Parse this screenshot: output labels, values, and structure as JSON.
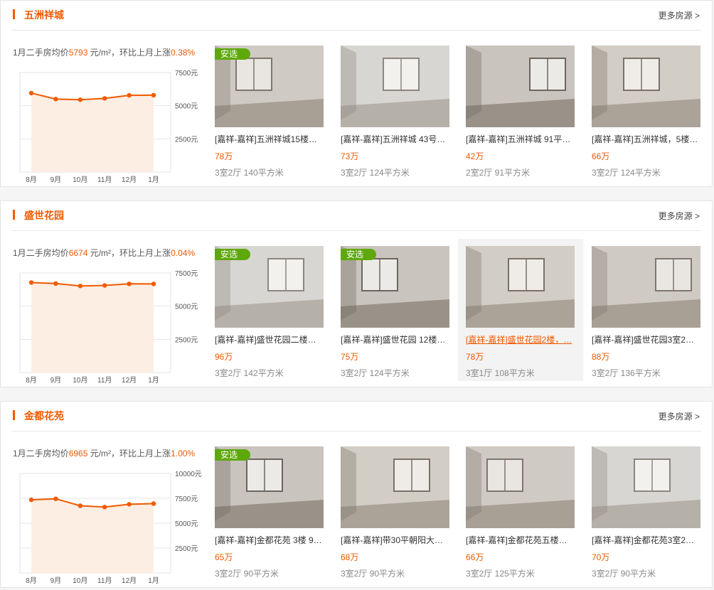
{
  "sections": [
    {
      "title": "五洲祥城",
      "more": "更多房源 >",
      "price_prefix": "1月二手房均价",
      "price_value": "5793",
      "price_unit": " 元/m²，环比上月上涨",
      "price_change": "0.38%",
      "chart_data": {
        "type": "line",
        "categories": [
          "8月",
          "9月",
          "10月",
          "11月",
          "12月",
          "1月"
        ],
        "values": [
          5950,
          5500,
          5450,
          5550,
          5780,
          5793
        ],
        "yticks": [
          "7500元",
          "5000元",
          "2500元"
        ],
        "ylim": [
          0,
          7500
        ]
      },
      "listings": [
        {
          "tag": "安选",
          "name": "[嘉祥-嘉祥]五洲祥城15楼…",
          "price": "78万",
          "spec": "3室2厅 140平方米"
        },
        {
          "tag": "",
          "name": "[嘉祥-嘉祥]五洲祥城 43号…",
          "price": "73万",
          "spec": "3室2厅 124平方米"
        },
        {
          "tag": "",
          "name": "[嘉祥-嘉祥]五洲祥城 91平…",
          "price": "42万",
          "spec": "2室2厅 91平方米"
        },
        {
          "tag": "",
          "name": "[嘉祥-嘉祥]五洲祥城，5楼…",
          "price": "66万",
          "spec": "3室2厅 124平方米"
        }
      ]
    },
    {
      "title": "盛世花园",
      "more": "更多房源 >",
      "price_prefix": "1月二手房均价",
      "price_value": "6674",
      "price_unit": " 元/m²，环比上月上涨",
      "price_change": "0.04%",
      "chart_data": {
        "type": "line",
        "categories": [
          "8月",
          "9月",
          "10月",
          "11月",
          "12月",
          "1月"
        ],
        "values": [
          6780,
          6700,
          6520,
          6560,
          6680,
          6674
        ],
        "yticks": [
          "7500元",
          "5000元",
          "2500元"
        ],
        "ylim": [
          0,
          7500
        ]
      },
      "listings": [
        {
          "tag": "安选",
          "name": "[嘉祥-嘉祥]盛世花园二楼…",
          "price": "96万",
          "spec": "3室2厅 142平方米"
        },
        {
          "tag": "安选",
          "name": "[嘉祥-嘉祥]盛世花园 12楼…",
          "price": "75万",
          "spec": "3室2厅 124平方米"
        },
        {
          "tag": "",
          "name": "[嘉祥-嘉祥]盛世花园2楼，…",
          "price": "78万",
          "spec": "3室1厅 108平方米"
        },
        {
          "tag": "",
          "name": "[嘉祥-嘉祥]盛世花园3室2…",
          "price": "88万",
          "spec": "3室2厅 136平方米"
        }
      ]
    },
    {
      "title": "金都花苑",
      "more": "更多房源 >",
      "price_prefix": "1月二手房均价",
      "price_value": "6965",
      "price_unit": " 元/m²，环比上月上涨",
      "price_change": "1.00%",
      "chart_data": {
        "type": "line",
        "categories": [
          "8月",
          "9月",
          "10月",
          "11月",
          "12月",
          "1月"
        ],
        "values": [
          7350,
          7450,
          6750,
          6620,
          6900,
          6965
        ],
        "yticks": [
          "10000元",
          "7500元",
          "5000元",
          "2500元"
        ],
        "ylim": [
          0,
          10000
        ]
      },
      "listings": [
        {
          "tag": "安选",
          "name": "[嘉祥-嘉祥]金都花苑 3楼 9…",
          "price": "65万",
          "spec": "3室2厅 90平方米"
        },
        {
          "tag": "",
          "name": "[嘉祥-嘉祥]带30平朝阳大…",
          "price": "68万",
          "spec": "3室2厅 90平方米"
        },
        {
          "tag": "",
          "name": "[嘉祥-嘉祥]金都花苑五楼…",
          "price": "66万",
          "spec": "3室2厅 125平方米"
        },
        {
          "tag": "",
          "name": "[嘉祥-嘉祥]金都花苑3室2…",
          "price": "70万",
          "spec": "3室2厅 90平方米"
        }
      ]
    }
  ],
  "colors": {
    "accent": "#f05a00",
    "tag": "#5fa80b",
    "area": "#fdeee4"
  }
}
